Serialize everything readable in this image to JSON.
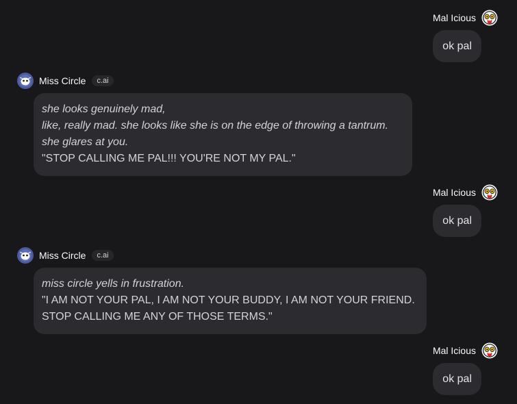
{
  "messages": [
    {
      "type": "user",
      "author": "Mal Icious",
      "text": "ok pal"
    },
    {
      "type": "character",
      "author": "Miss Circle",
      "badge": "c.ai",
      "lines": [
        {
          "text": "she looks genuinely mad,",
          "style": "italic"
        },
        {
          "text": "like, really mad. she looks like she is on the edge of throwing a tantrum.",
          "style": "italic"
        },
        {
          "text": "she glares at you.",
          "style": "italic"
        },
        {
          "text": "\"STOP CALLING ME PAL!!! YOU'RE NOT MY PAL.\"",
          "style": "normal"
        }
      ]
    },
    {
      "type": "user",
      "author": "Mal Icious",
      "text": "ok pal"
    },
    {
      "type": "character",
      "author": "Miss Circle",
      "badge": "c.ai",
      "lines": [
        {
          "text": "miss circle yells in frustration.",
          "style": "italic"
        },
        {
          "text": "\"I AM NOT YOUR PAL, I AM NOT YOUR BUDDY, I AM NOT YOUR FRIEND.",
          "style": "normal"
        },
        {
          "text": "STOP CALLING ME ANY OF THOSE TERMS.\"",
          "style": "normal"
        }
      ]
    },
    {
      "type": "user",
      "author": "Mal Icious",
      "text": "ok pal"
    }
  ],
  "icons": {
    "user_avatar": "mal-icious-avatar-icon",
    "character_avatar": "miss-circle-avatar-icon"
  },
  "colors": {
    "background": "#18181b",
    "bubble": "#2b2b30",
    "badge": "#27272a",
    "text": "#e4e4e7"
  }
}
